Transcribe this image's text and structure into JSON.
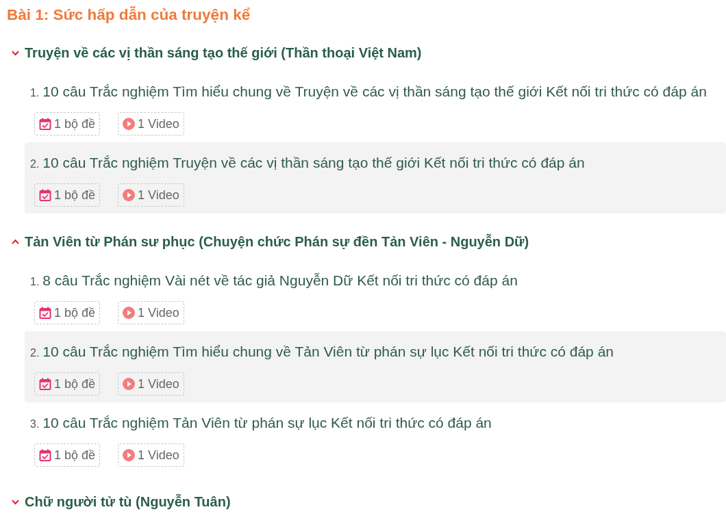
{
  "title": "Bài 1: Sức hấp dẫn của truyện kể",
  "sections": [
    {
      "heading": "Truyện về các vị thần sáng tạo thế giới (Thần thoại Việt Nam)",
      "expanded": false,
      "items": [
        {
          "number": "1.",
          "text": "10 câu Trắc nghiệm Tìm hiểu chung về Truyện về các vị thần sáng tạo thế giới Kết nối tri thức có đáp án",
          "selected": false,
          "badges": [
            {
              "kind": "quiz",
              "label": "1 bộ đề"
            },
            {
              "kind": "video",
              "label": "1 Video"
            }
          ]
        },
        {
          "number": "2.",
          "text": "10 câu Trắc nghiệm Truyện về các vị thần sáng tạo thế giới Kết nối tri thức có đáp án",
          "selected": true,
          "badges": [
            {
              "kind": "quiz",
              "label": "1 bộ đề"
            },
            {
              "kind": "video",
              "label": "1 Video"
            }
          ]
        }
      ]
    },
    {
      "heading": "Tản Viên từ Phán sư phục (Chuyện chức Phán sự đền Tản Viên - Nguyễn Dữ)",
      "expanded": true,
      "items": [
        {
          "number": "1.",
          "text": "8 câu Trắc nghiệm Vài nét về tác giả Nguyễn Dữ Kết nối tri thức có đáp án",
          "selected": false,
          "badges": [
            {
              "kind": "quiz",
              "label": "1 bộ đề"
            },
            {
              "kind": "video",
              "label": "1 Video"
            }
          ]
        },
        {
          "number": "2.",
          "text": "10 câu Trắc nghiệm Tìm hiểu chung về Tản Viên từ phán sự lục Kết nối tri thức có đáp án",
          "selected": true,
          "badges": [
            {
              "kind": "quiz",
              "label": "1 bộ đề"
            },
            {
              "kind": "video",
              "label": "1 Video"
            }
          ]
        },
        {
          "number": "3.",
          "text": "10 câu Trắc nghiệm Tản Viên từ phán sự lục Kết nối tri thức có đáp án",
          "selected": false,
          "badges": [
            {
              "kind": "quiz",
              "label": "1 bộ đề"
            },
            {
              "kind": "video",
              "label": "1 Video"
            }
          ]
        }
      ]
    },
    {
      "heading": "Chữ người tử tù (Nguyễn Tuân)",
      "expanded": false
    }
  ]
}
